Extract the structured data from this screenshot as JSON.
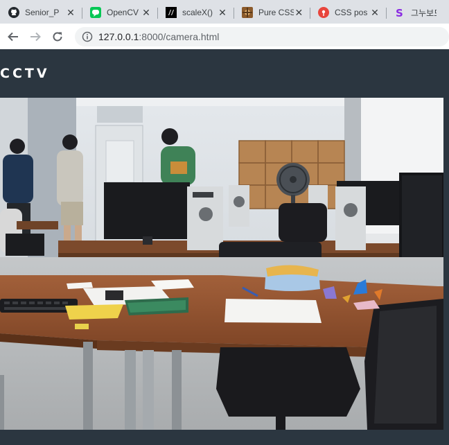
{
  "browser": {
    "tabs": [
      {
        "title": "Senior_P",
        "icon": "github-icon",
        "color": "#24292e"
      },
      {
        "title": "OpenCV",
        "icon": "line-icon",
        "color": "#06c755"
      },
      {
        "title": "scaleX()",
        "icon": "mdn-icon",
        "color": "#000000"
      },
      {
        "title": "Pure CSS",
        "icon": "codepen-icon",
        "color": "#8b5a2b"
      },
      {
        "title": "CSS pos",
        "icon": "pinterest-icon",
        "color": "#e60023"
      },
      {
        "title": "그누보드",
        "icon": "sir-icon",
        "color": "#8a2be2"
      }
    ],
    "address": {
      "host": "127.0.0.1",
      "path": ":8000/camera.html"
    }
  },
  "page": {
    "title": "CCTV",
    "background": "#2b3640"
  },
  "camera": {
    "description_icon": "cctv-feed-image"
  }
}
